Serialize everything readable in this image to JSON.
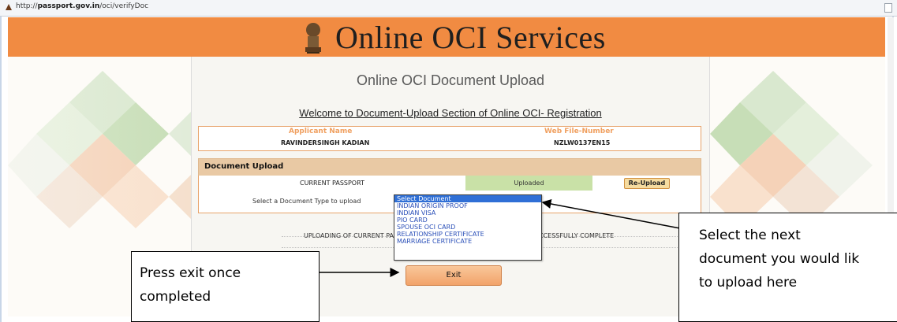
{
  "browser": {
    "url_prefix": "http://",
    "url_host": "passport.gov.in",
    "url_path": "/oci/verifyDoc"
  },
  "banner": {
    "title": "Online OCI Services"
  },
  "page": {
    "heading": "Online OCI Document Upload",
    "subheading": "Welcome to Document-Upload Section of Online OCI- Registration"
  },
  "applicant": {
    "name_label": "Applicant Name",
    "name_value": "RAVINDERSINGH KADIAN",
    "file_label": "Web File-Number",
    "file_value": "NZLW0137EN15"
  },
  "upload": {
    "section_title": "Document Upload",
    "current_doc": "CURRENT PASSPORT",
    "current_status": "Uploaded",
    "reupload_label": "Re-Upload",
    "select_label": "Select a Document Type to upload"
  },
  "dropdown": {
    "options": [
      "Select Document",
      "INDIAN ORIGIN PROOF",
      "INDIAN VISA",
      "PIO CARD",
      "SPOUSE OCI CARD",
      "RELATIONSHIP CERTIFICATE",
      "MARRIAGE CERTIFICATE"
    ],
    "selected_index": 0
  },
  "status": {
    "left": "UPLOADING OF CURRENT PA",
    "right": "CCESSFULLY COMPLETE"
  },
  "exit_label": "Exit",
  "callouts": {
    "exit_line1": "Press exit once",
    "exit_line2": "completed",
    "select_line1": "Select the next",
    "select_line2": "document you would lik",
    "select_line3": "to upload here"
  },
  "colors": {
    "banner": "#f18b42",
    "header_band": "#e9c9a4",
    "uploaded": "#c9e1a7",
    "accent_label": "#f0a060"
  }
}
